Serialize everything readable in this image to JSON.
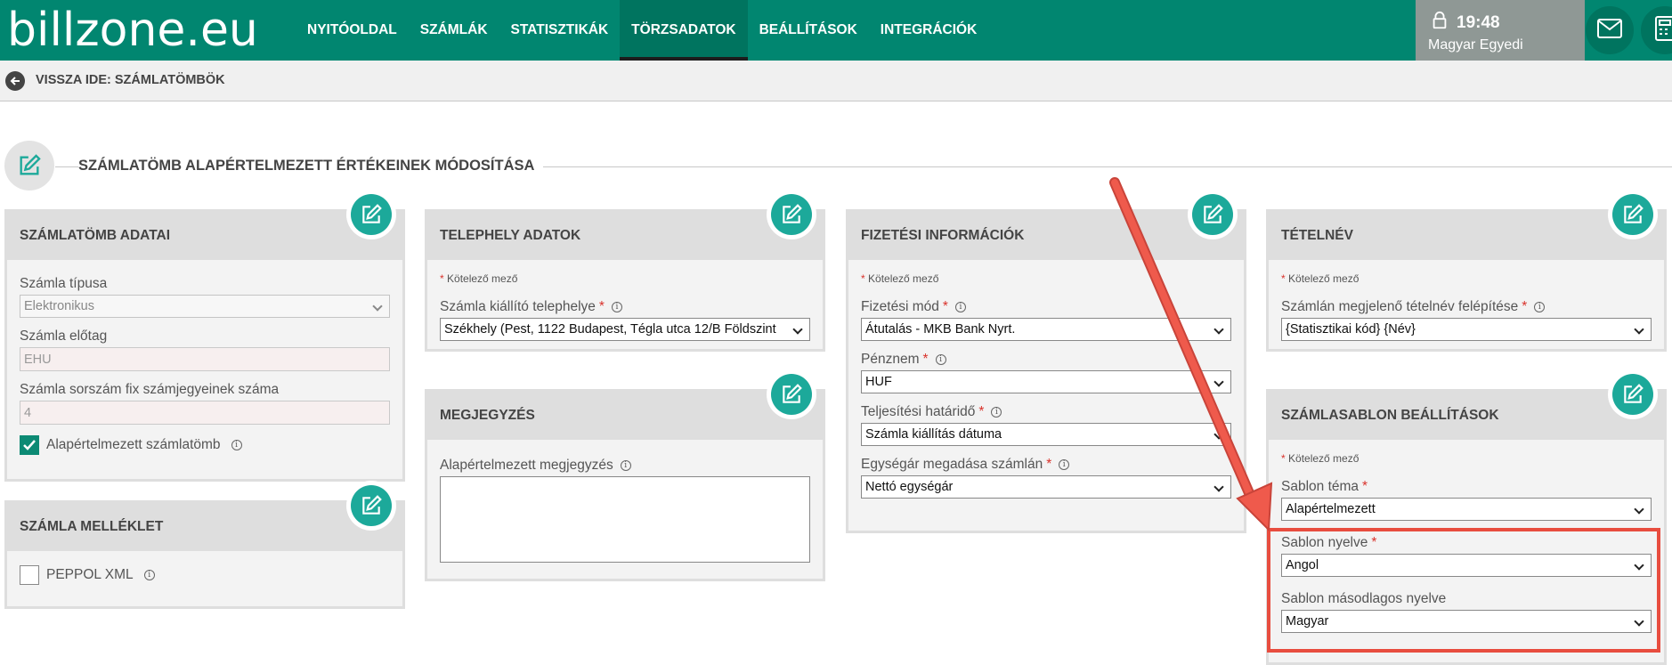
{
  "brand": {
    "logo_text": "billzone.eu"
  },
  "nav": {
    "items": [
      {
        "label": "NYITÓOLDAL",
        "active": false
      },
      {
        "label": "SZÁMLÁK",
        "active": false
      },
      {
        "label": "STATISZTIKÁK",
        "active": false
      },
      {
        "label": "TÖRZSADATOK",
        "active": true
      },
      {
        "label": "BEÁLLÍTÁSOK",
        "active": false
      },
      {
        "label": "INTEGRÁCIÓK",
        "active": false
      }
    ]
  },
  "user": {
    "time": "19:48",
    "name": "Magyar Egyedi"
  },
  "subbar": {
    "back_label": "VISSZA IDE: SZÁMLATÖMBÖK"
  },
  "page": {
    "title": "SZÁMLATÖMB ALAPÉRTELMEZETT ÉRTÉKEINEK MÓDOSÍTÁSA"
  },
  "required_note": "Kötelező mező",
  "cards": {
    "szamlatomb": {
      "title": "SZÁMLATÖMB ADATAI",
      "tipus_label": "Számla típusa",
      "tipus_value": "Elektronikus",
      "elotag_label": "Számla előtag",
      "elotag_value": "EHU",
      "sorszam_label": "Számla sorszám fix számjegyeinek száma",
      "sorszam_value": "4",
      "default_label": "Alapértelmezett számlatömb",
      "default_checked": true
    },
    "melleklet": {
      "title": "SZÁMLA MELLÉKLET",
      "peppol_label": "PEPPOL XML",
      "peppol_checked": false
    },
    "telephely": {
      "title": "TELEPHELY ADATOK",
      "telephely_label": "Számla kiállító telephelye",
      "telephely_value": "Székhely (Pest, 1122 Budapest, Tégla utca 12/B Földszint"
    },
    "megjegyzes": {
      "title": "MEGJEGYZÉS",
      "megjegyzes_label": "Alapértelmezett megjegyzés",
      "megjegyzes_value": ""
    },
    "fizetes": {
      "title": "FIZETÉSI INFORMÁCIÓK",
      "mod_label": "Fizetési mód",
      "mod_value": "Átutalás - MKB Bank Nyrt.",
      "penznem_label": "Pénznem",
      "penznem_value": "HUF",
      "hatarido_label": "Teljesítési határidő",
      "hatarido_value": "Számla kiállítás dátuma",
      "egysegar_label": "Egységár megadása számlán",
      "egysegar_value": "Nettó egységár"
    },
    "tetelnev": {
      "title": "TÉTELNÉV",
      "felepites_label": "Számlán megjelenő tételnév felépítése",
      "felepites_value": "{Statisztikai kód} {Név}"
    },
    "sablon": {
      "title": "SZÁMLASABLON BEÁLLÍTÁSOK",
      "tema_label": "Sablon téma",
      "tema_value": "Alapértelmezett",
      "nyelv_label": "Sablon nyelve",
      "nyelv_value": "Angol",
      "masodlagos_label": "Sablon másodlagos nyelve",
      "masodlagos_value": "Magyar"
    }
  },
  "colors": {
    "brand_green": "#018670",
    "accent_teal": "#1ca99a",
    "highlight_red": "#e84d3f",
    "required_red": "#d9322b"
  }
}
